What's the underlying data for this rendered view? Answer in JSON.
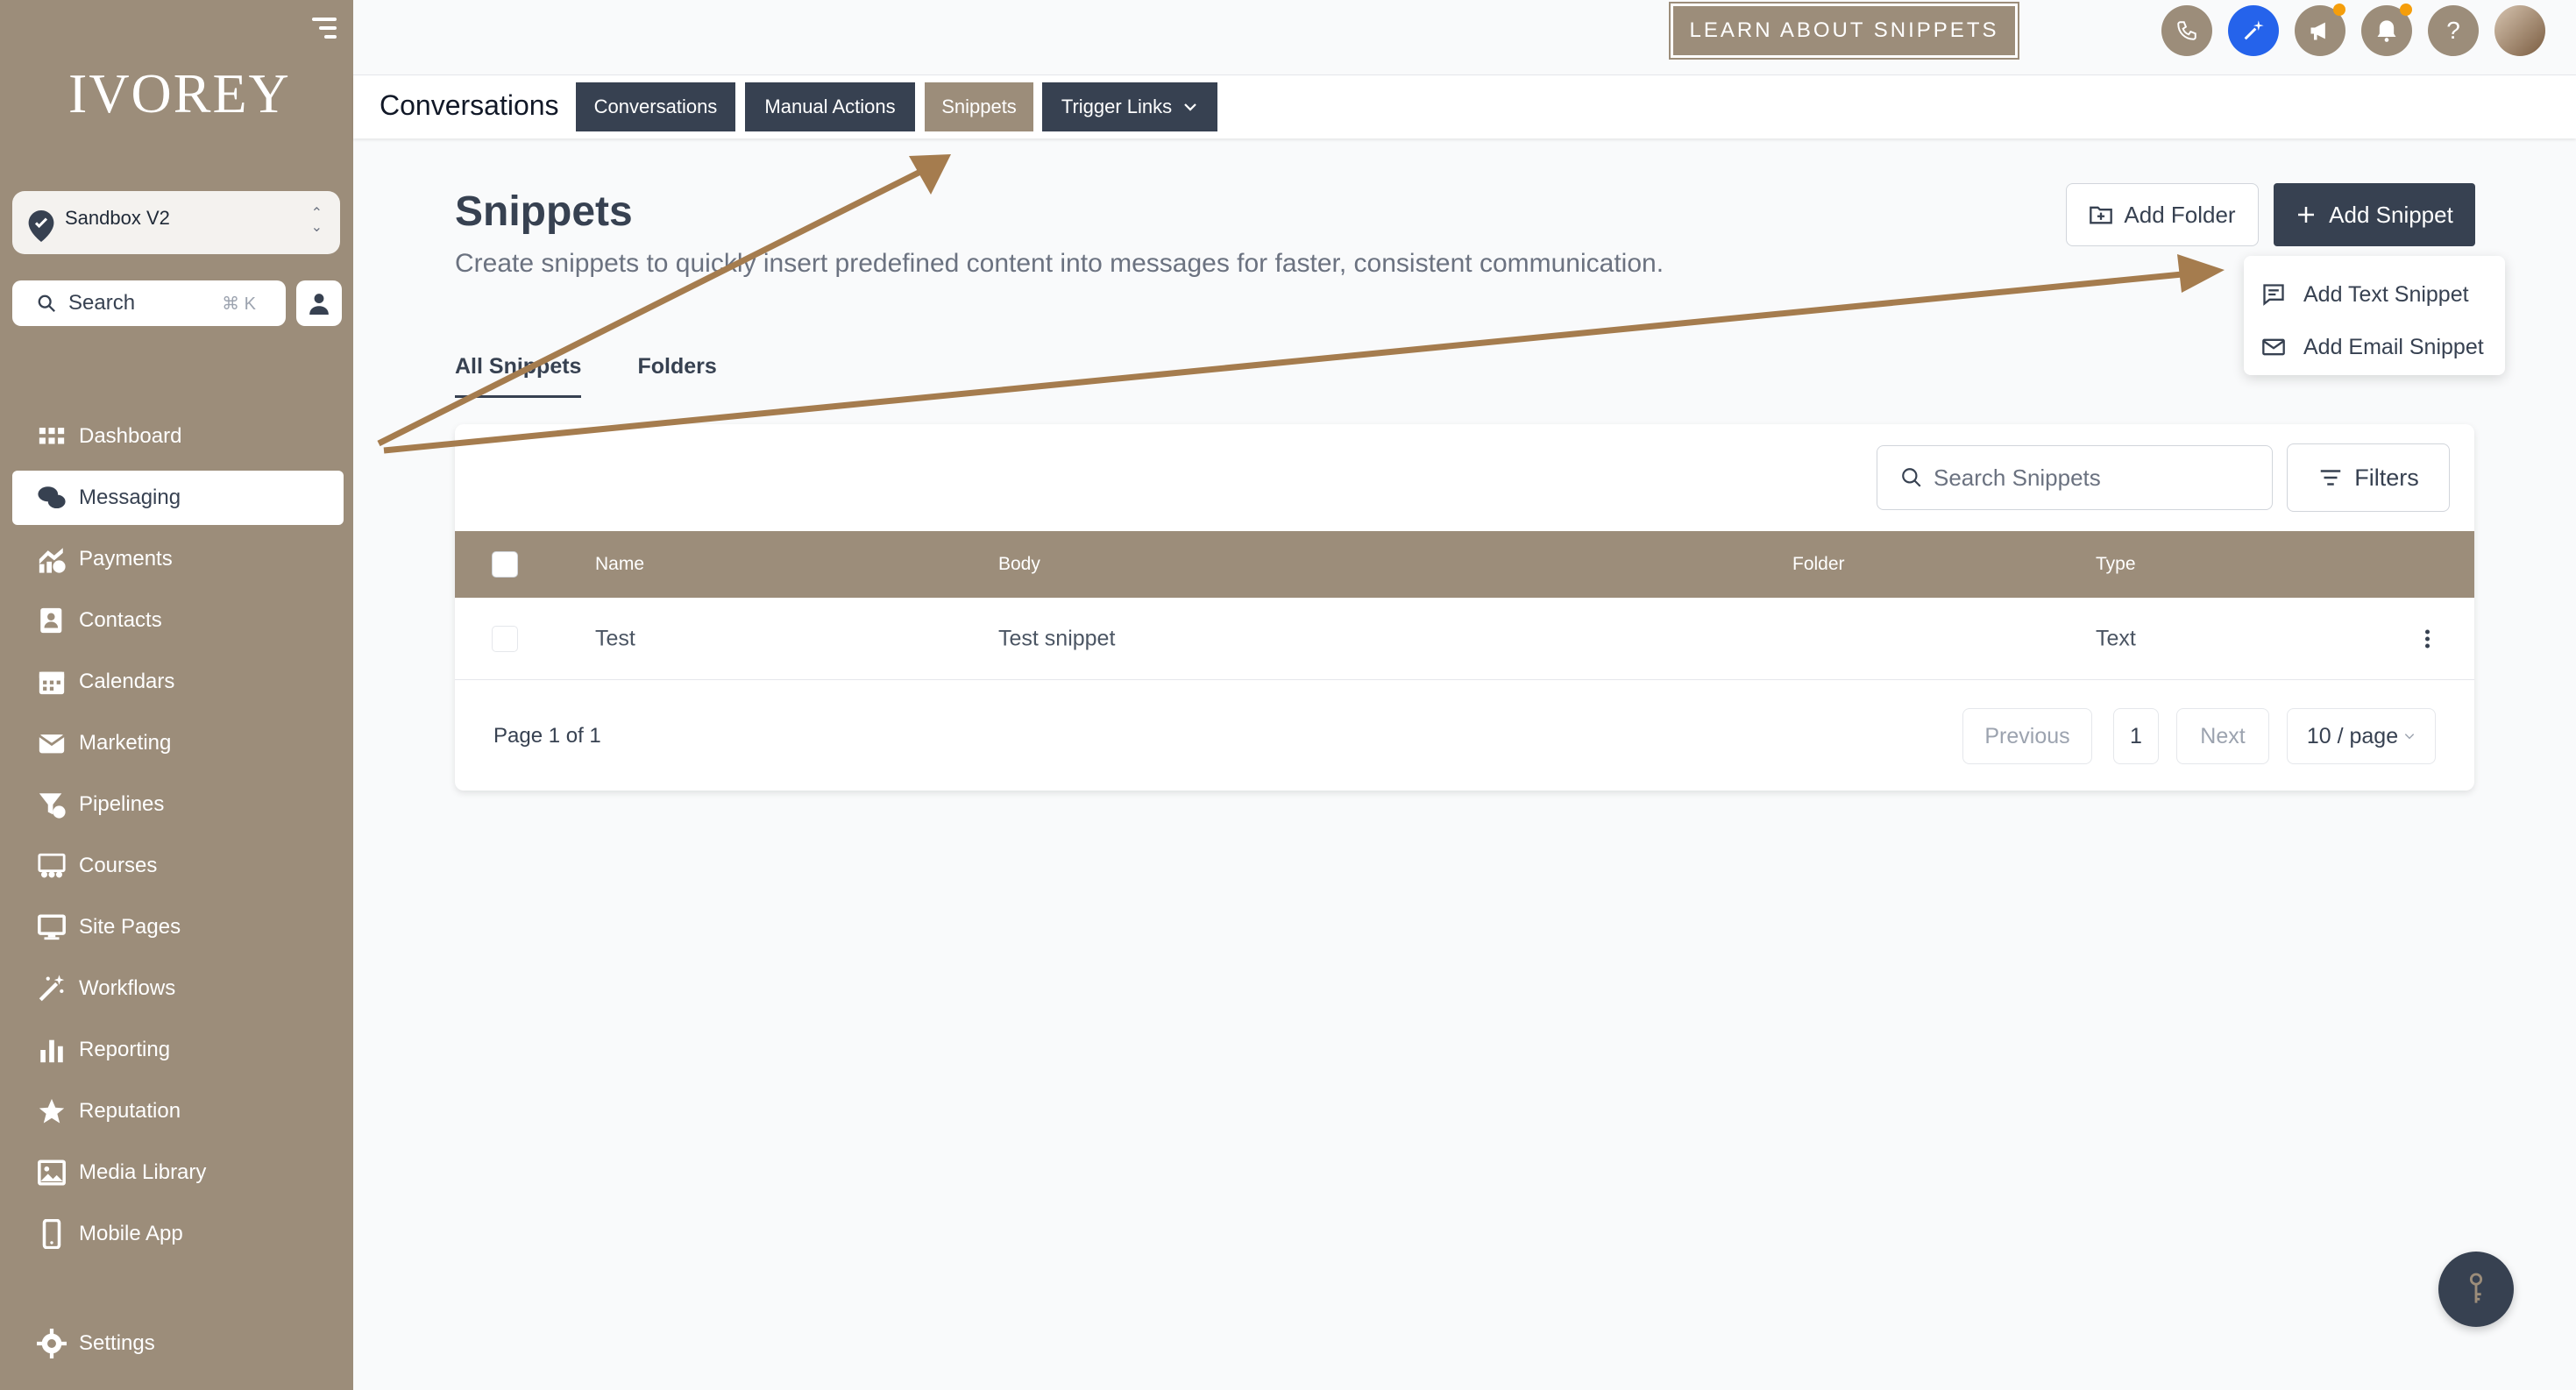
{
  "sidebar": {
    "logo": "IVOREY",
    "account": "Sandbox V2",
    "search_label": "Search",
    "search_shortcut": "⌘ K",
    "items": [
      {
        "label": "Dashboard",
        "icon": "dashboard-icon"
      },
      {
        "label": "Messaging",
        "icon": "chat-icon"
      },
      {
        "label": "Payments",
        "icon": "payments-icon"
      },
      {
        "label": "Contacts",
        "icon": "contacts-icon"
      },
      {
        "label": "Calendars",
        "icon": "calendar-icon"
      },
      {
        "label": "Marketing",
        "icon": "mail-icon"
      },
      {
        "label": "Pipelines",
        "icon": "funnel-icon"
      },
      {
        "label": "Courses",
        "icon": "courses-icon"
      },
      {
        "label": "Site Pages",
        "icon": "monitor-icon"
      },
      {
        "label": "Workflows",
        "icon": "wand-icon"
      },
      {
        "label": "Reporting",
        "icon": "bar-chart-icon"
      },
      {
        "label": "Reputation",
        "icon": "star-icon"
      },
      {
        "label": "Media Library",
        "icon": "image-icon"
      },
      {
        "label": "Mobile App",
        "icon": "phone-icon"
      }
    ],
    "settings_label": "Settings"
  },
  "topbar": {
    "learn_button": "LEARN ABOUT SNIPPETS",
    "help_glyph": "?"
  },
  "tabs": {
    "title": "Conversations",
    "items": [
      "Conversations",
      "Manual Actions",
      "Snippets",
      "Trigger Links"
    ],
    "selected": "Snippets"
  },
  "page": {
    "title": "Snippets",
    "description": "Create snippets to quickly insert predefined content into messages for faster, consistent communication.",
    "add_folder": "Add Folder",
    "add_snippet": "Add Snippet",
    "dropdown": [
      "Add Text Snippet",
      "Add Email Snippet"
    ],
    "subtabs": [
      "All Snippets",
      "Folders"
    ]
  },
  "table": {
    "search_placeholder": "Search Snippets",
    "filters": "Filters",
    "columns": [
      "Name",
      "Body",
      "Folder",
      "Type"
    ],
    "rows": [
      {
        "name": "Test",
        "body": "Test snippet",
        "folder": "",
        "type": "Text"
      }
    ],
    "page_info": "Page 1 of 1",
    "previous": "Previous",
    "page_number": "1",
    "next": "Next",
    "page_size": "10 / page"
  },
  "colors": {
    "brand": "#9c8d7a",
    "dark": "#374151",
    "accent_blue": "#2563eb",
    "arrow": "#a57c4e"
  }
}
